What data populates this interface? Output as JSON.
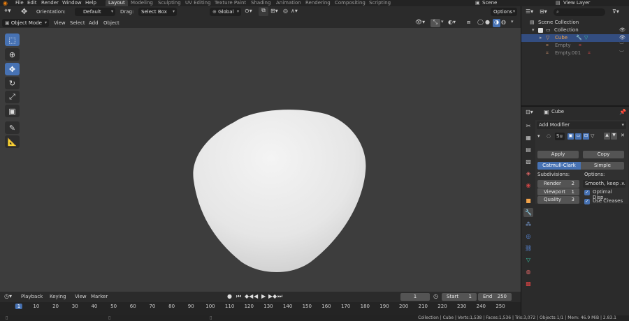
{
  "menu": [
    "File",
    "Edit",
    "Render",
    "Window",
    "Help"
  ],
  "workspaces": [
    "Layout",
    "Modeling",
    "Sculpting",
    "UV Editing",
    "Texture Paint",
    "Shading",
    "Animation",
    "Rendering",
    "Compositing",
    "Scripting"
  ],
  "scene": {
    "name": "Scene",
    "view_layer": "View Layer"
  },
  "header": {
    "orientation_label": "Orientation:",
    "orientation_value": "Default",
    "drag_label": "Drag:",
    "drag_value": "Select Box",
    "transform_value": "Global",
    "options": "Options"
  },
  "viewport_header": {
    "mode": "Object Mode",
    "menus": [
      "View",
      "Select",
      "Add",
      "Object"
    ]
  },
  "outliner": {
    "scene_collection": "Scene Collection",
    "collection": "Collection",
    "items": [
      "Cube",
      "Empty",
      "Empty.001"
    ]
  },
  "properties": {
    "object_name": "Cube",
    "add_modifier": "Add Modifier",
    "modifier_short": "Su",
    "apply": "Apply",
    "copy": "Copy",
    "type_catmull": "Catmull-Clark",
    "type_simple": "Simple",
    "subdivisions_label": "Subdivisions:",
    "options_label": "Options:",
    "render_label": "Render",
    "render_value": "2",
    "viewport_label": "Viewport",
    "viewport_value": "1",
    "quality_label": "Quality",
    "quality_value": "3",
    "uv_smooth": "Smooth, keep ...",
    "optimal_display": "Optimal Disp...",
    "use_creases": "Use Creases"
  },
  "timeline": {
    "menus": [
      "Playback",
      "Keying",
      "View",
      "Marker"
    ],
    "current_frame": "1",
    "start_label": "Start",
    "start_value": "1",
    "end_label": "End",
    "end_value": "250",
    "ticks": [
      "1",
      "10",
      "20",
      "30",
      "40",
      "50",
      "60",
      "70",
      "80",
      "90",
      "100",
      "110",
      "120",
      "130",
      "140",
      "150",
      "160",
      "170",
      "180",
      "190",
      "200",
      "210",
      "220",
      "230",
      "240",
      "250"
    ]
  },
  "status_bar": "Collection | Cube | Verts:1,538 | Faces:1,536 | Tris:3,072 | Objects:1/1 | Mem: 46.9 MiB | 2.83.1",
  "colors": {
    "accent": "#4772b3",
    "viewport_bg": "#3d3d3d",
    "selected_row": "#334d80",
    "active_object": "#f2a34a"
  }
}
